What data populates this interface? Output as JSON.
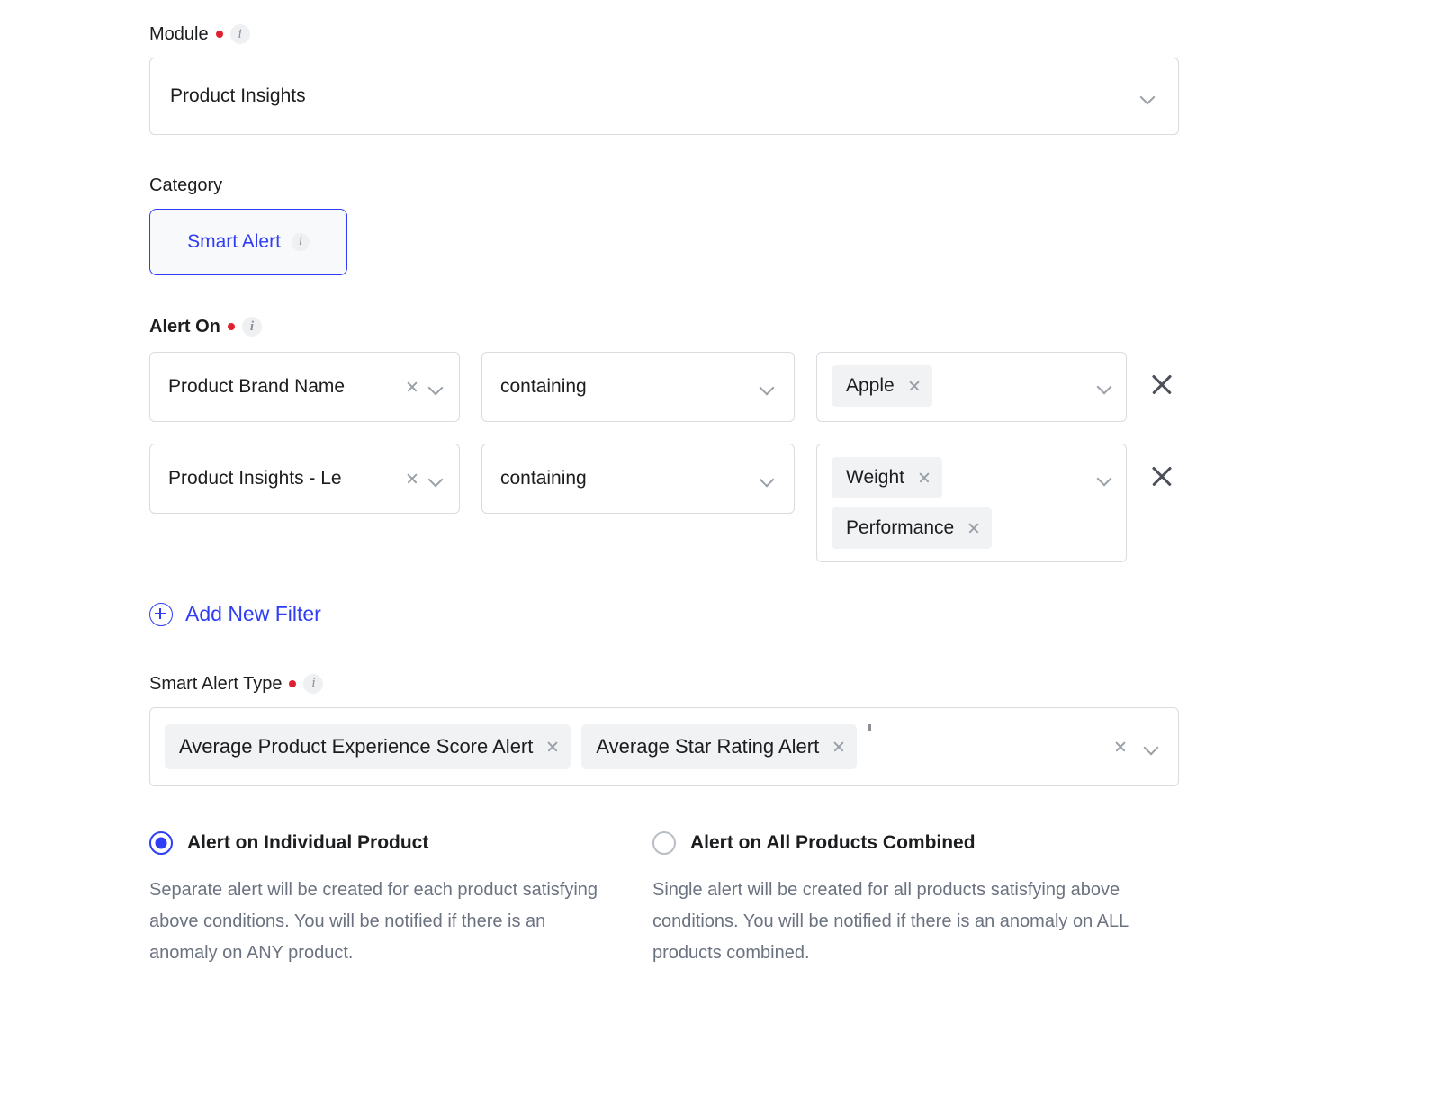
{
  "module": {
    "label": "Module",
    "required": true,
    "info_icon": "info-icon",
    "value": "Product Insights"
  },
  "category": {
    "label": "Category",
    "selected_option": "Smart Alert",
    "info_icon": "info-icon"
  },
  "alert_on": {
    "label": "Alert On",
    "required": true,
    "info_icon": "info-icon",
    "filters": [
      {
        "field": "Product Brand Name",
        "operator": "containing",
        "values": [
          "Apple"
        ]
      },
      {
        "field": "Product Insights - Le",
        "operator": "containing",
        "values": [
          "Weight",
          "Performance"
        ]
      }
    ],
    "add_filter_label": "Add New Filter",
    "add_filter_icon": "plus-circle-icon"
  },
  "smart_alert_type": {
    "label": "Smart Alert Type",
    "required": true,
    "info_icon": "info-icon",
    "values": [
      "Average Product Experience Score Alert",
      "Average Star Rating Alert"
    ]
  },
  "alert_scope": {
    "options": [
      {
        "title": "Alert on Individual Product",
        "selected": true,
        "description": "Separate alert will be created for each product satisfying above conditions. You will be notified if there is an anomaly on ANY product."
      },
      {
        "title": "Alert on All Products Combined",
        "selected": false,
        "description": "Single alert will be created for all products satisfying above conditions. You will be notified if there is an anomaly on ALL products combined."
      }
    ]
  },
  "colors": {
    "accent": "#2f3df5",
    "required_dot": "#e0202f",
    "chip_bg": "#f1f2f4",
    "border": "#d9dce0",
    "muted_text": "#6b7280"
  }
}
